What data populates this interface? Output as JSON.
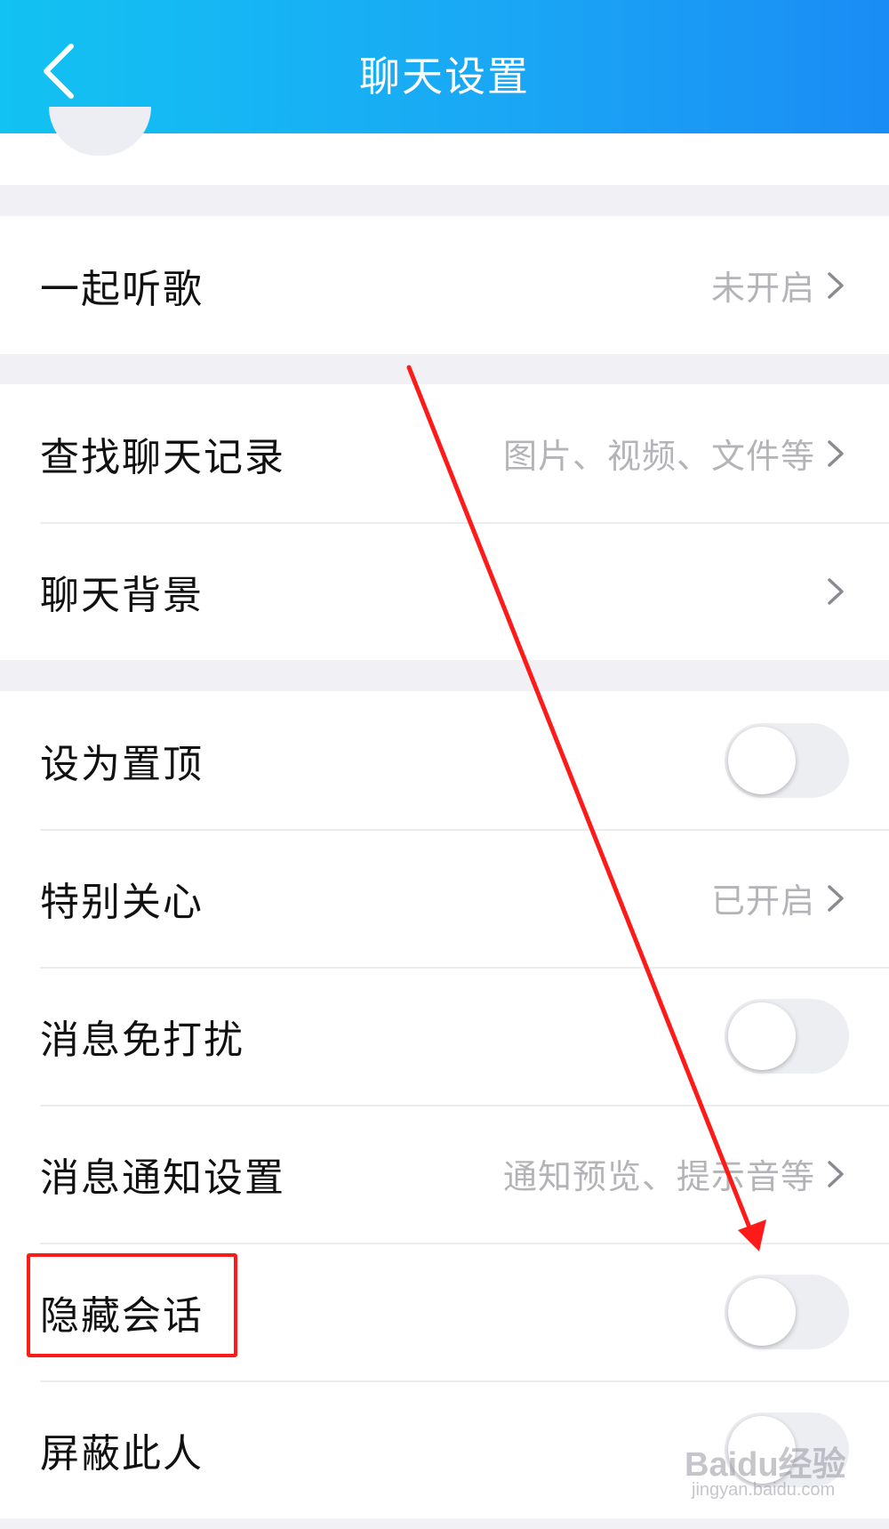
{
  "header": {
    "title": "聊天设置"
  },
  "groups": [
    {
      "rows": [
        {
          "label": "一起听歌",
          "value": "未开启"
        }
      ]
    },
    {
      "rows": [
        {
          "label": "查找聊天记录",
          "value": "图片、视频、文件等"
        },
        {
          "label": "聊天背景",
          "value": ""
        }
      ]
    },
    {
      "rows": [
        {
          "label": "设为置顶",
          "toggle": false
        },
        {
          "label": "特别关心",
          "value": "已开启"
        },
        {
          "label": "消息免打扰",
          "toggle": false
        },
        {
          "label": "消息通知设置",
          "value": "通知预览、提示音等"
        },
        {
          "label": "隐藏会话",
          "toggle": false
        },
        {
          "label": "屏蔽此人",
          "toggle": false
        }
      ]
    }
  ],
  "watermark": {
    "brand": "Baidu经验",
    "url": "jingyan.baidu.com"
  },
  "colors": {
    "header_start": "#12c2f2",
    "header_end": "#1a8cf5",
    "annotation_red": "#ff1a1a"
  }
}
